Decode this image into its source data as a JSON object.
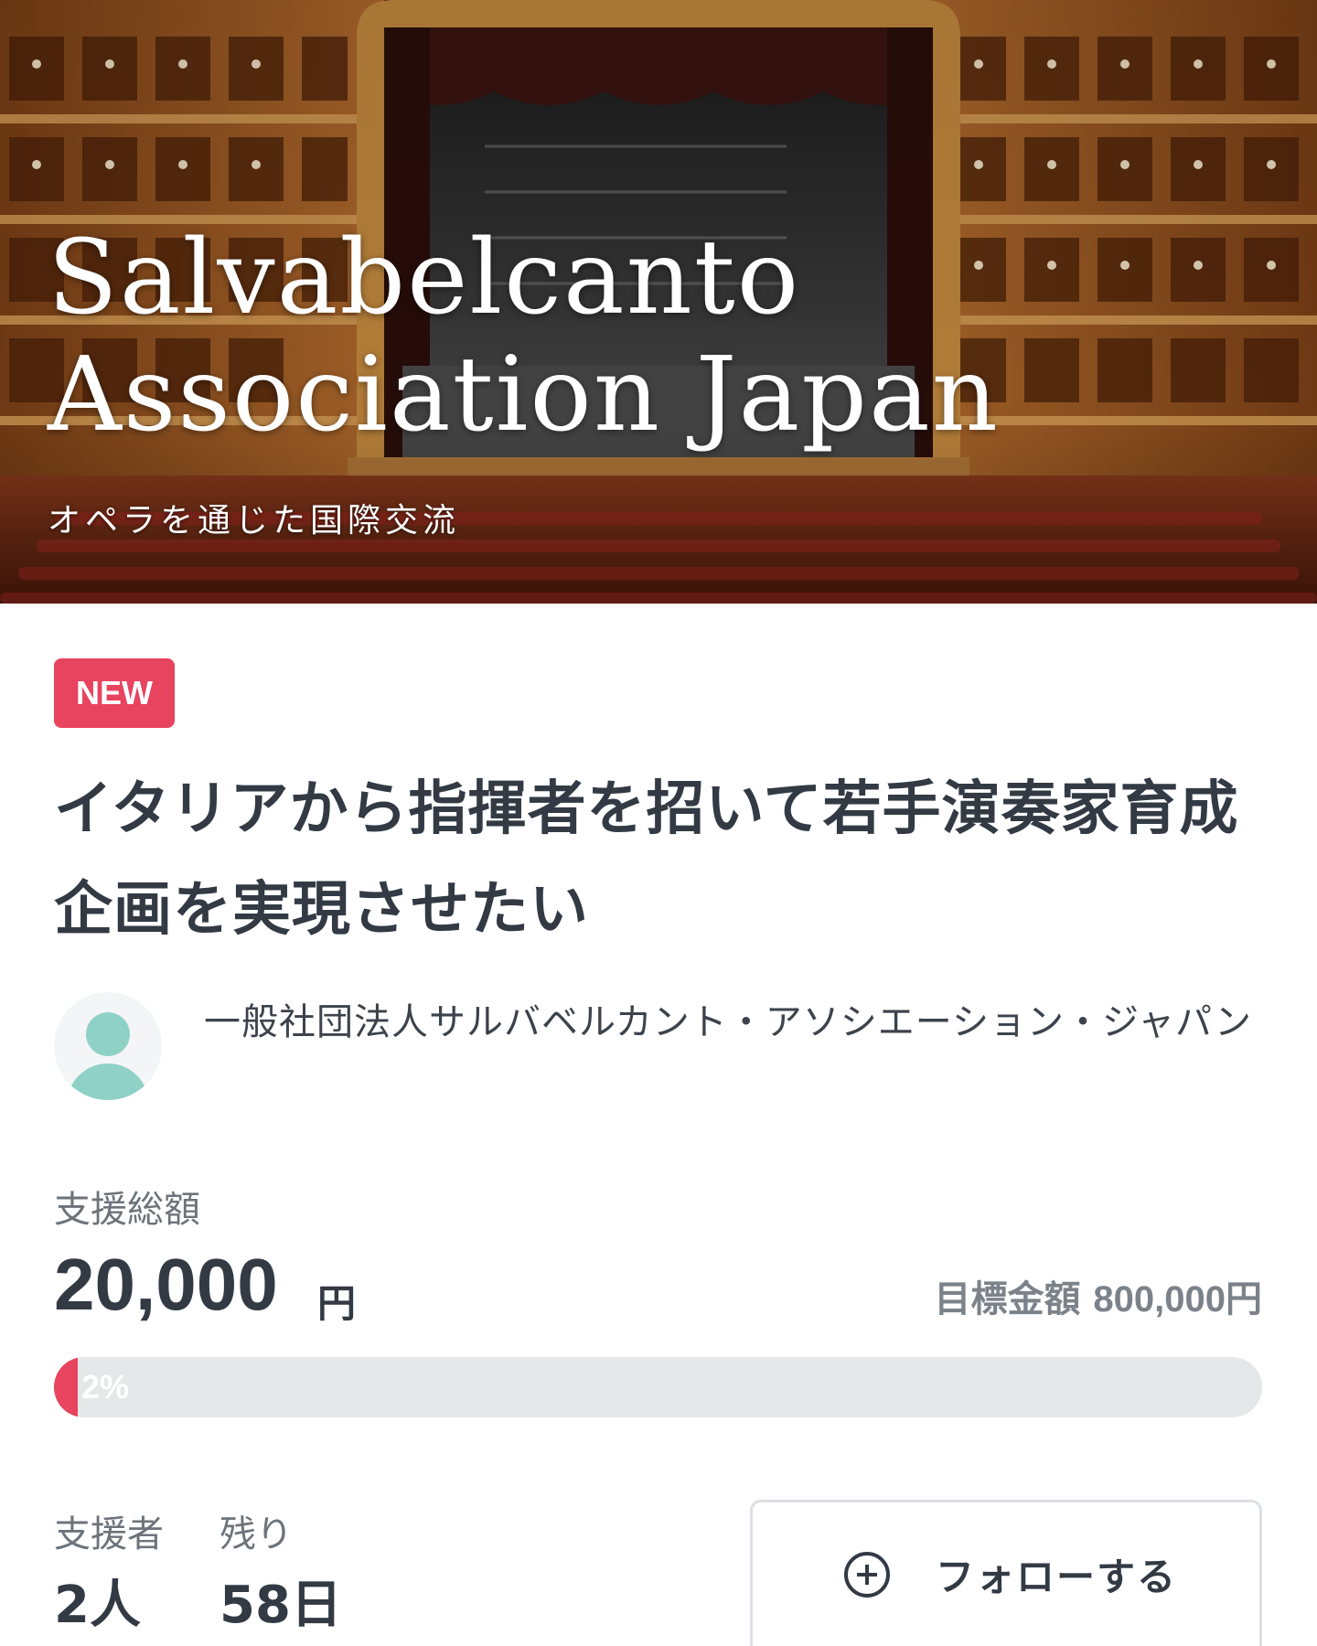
{
  "hero": {
    "title_line1": "Salvabelcanto",
    "title_line2": "Association Japan",
    "subtitle": "オペラを通じた国際交流"
  },
  "badge": "NEW",
  "project": {
    "title": "イタリアから指揮者を招いて若手演奏家育成企画を実現させたい"
  },
  "owner": {
    "name": "一般社団法人サルバベルカント・アソシエーション・ジャパン"
  },
  "funding": {
    "total_label": "支援総額",
    "total_amount": "20,000",
    "total_unit": "円",
    "goal_label": "目標金額",
    "goal_value": "800,000円",
    "progress_percent": 2,
    "progress_text": "2%"
  },
  "stats": {
    "supporters_label": "支援者",
    "supporters_value": "2人",
    "remaining_label": "残り",
    "remaining_value": "58日"
  },
  "follow": {
    "label": "フォローする",
    "icon": "plus-circle-icon"
  },
  "colors": {
    "accent": "#e8435f",
    "text": "#333a44",
    "avatar": "#8fd1c6",
    "track": "#e6e7e9"
  }
}
